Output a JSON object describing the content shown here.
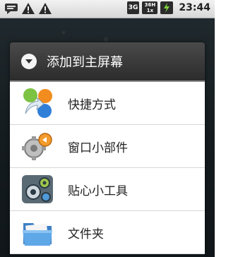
{
  "status_bar": {
    "icons": [
      "message-icon",
      "warning-icon",
      "warning-icon"
    ],
    "network_label": "3G",
    "signal_label_top": "36H",
    "signal_label_bottom": "1x",
    "clock": "23:44"
  },
  "dialog": {
    "title": "添加到主屏幕",
    "items": [
      {
        "label": "快捷方式",
        "icon": "shortcut-icon"
      },
      {
        "label": "窗口小部件",
        "icon": "widget-icon"
      },
      {
        "label": "贴心小工具",
        "icon": "gadget-icon"
      },
      {
        "label": "文件夹",
        "icon": "folder-icon"
      }
    ]
  }
}
